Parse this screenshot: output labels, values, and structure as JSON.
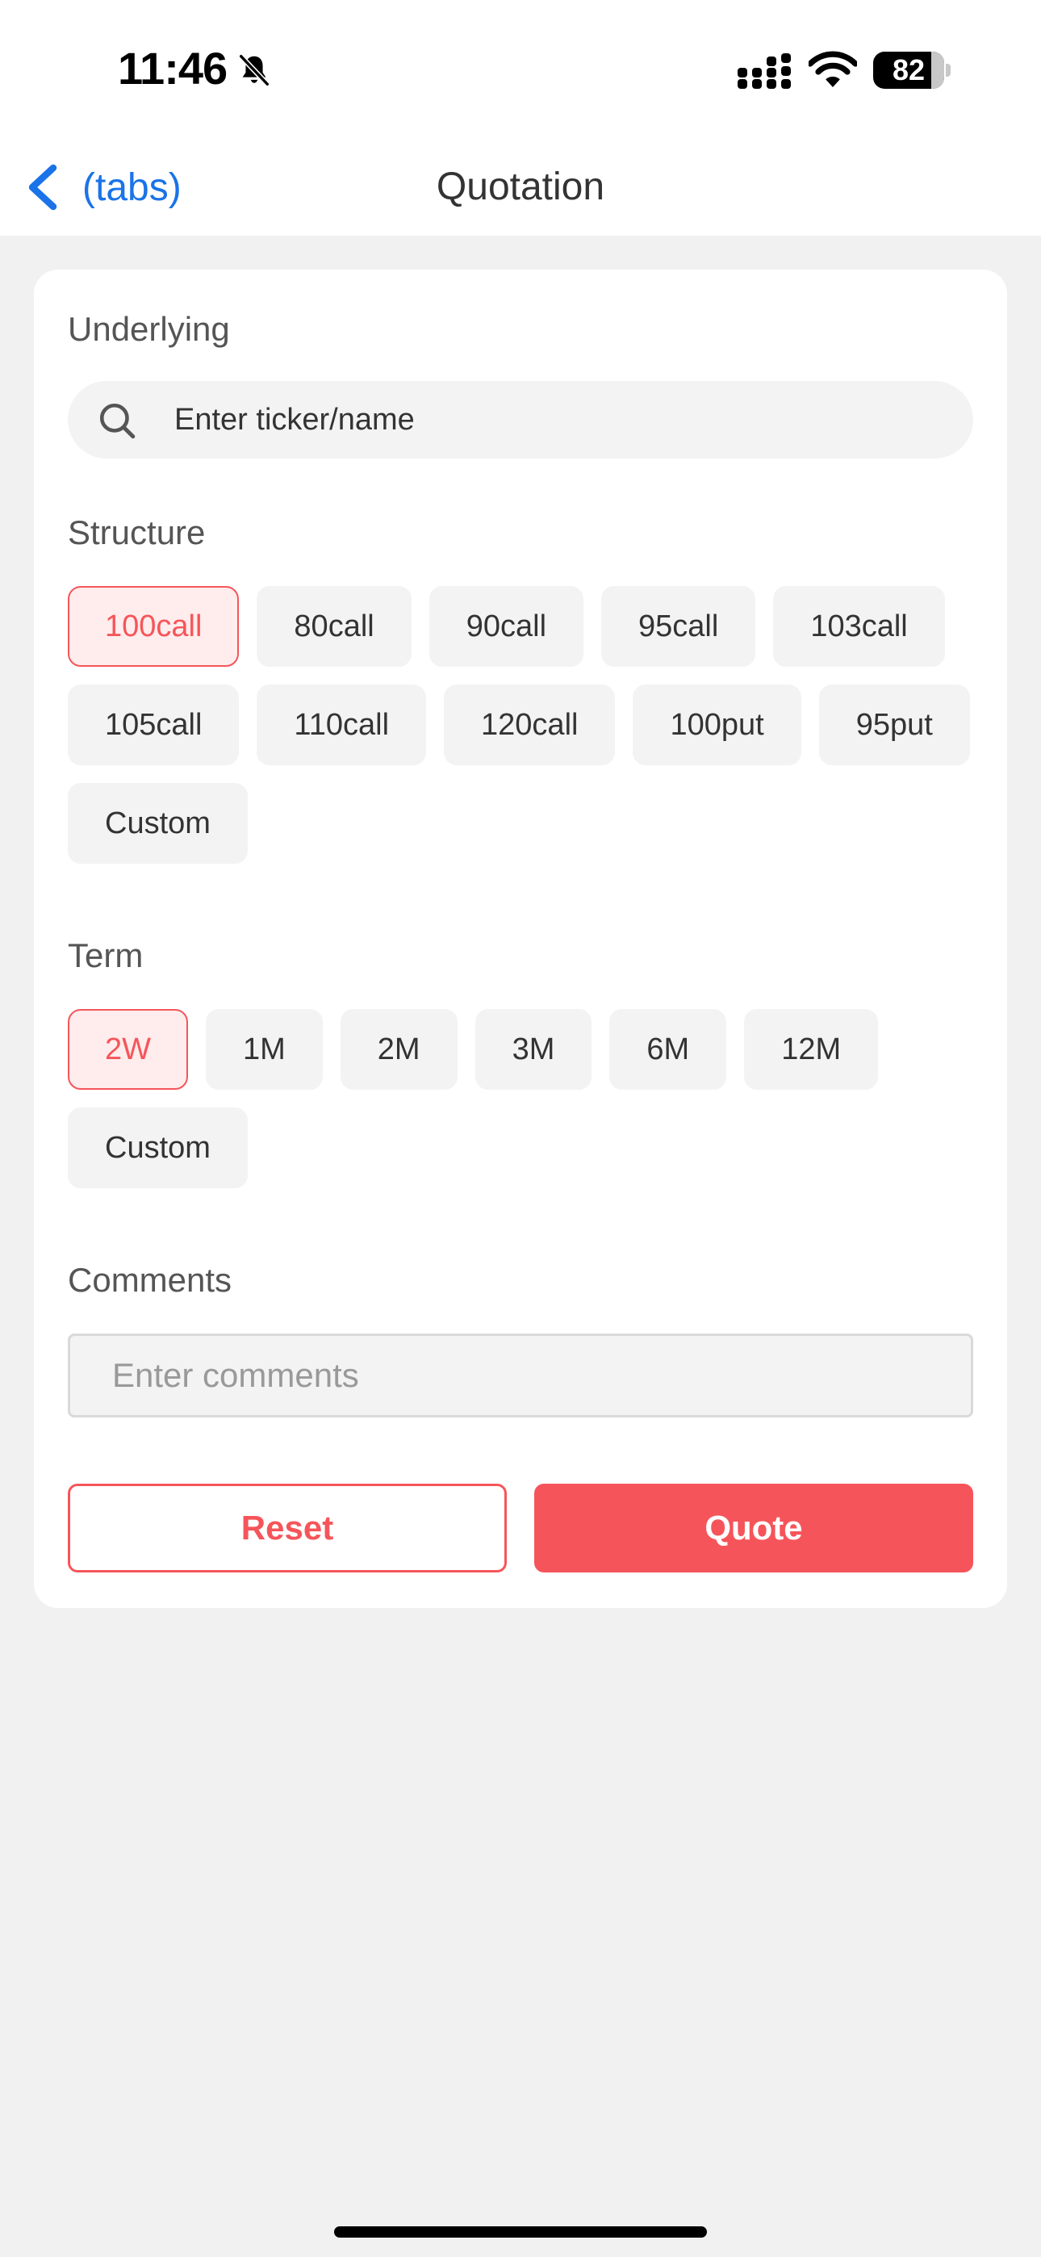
{
  "status_bar": {
    "time": "11:46",
    "battery_level": "82",
    "battery_fraction": 0.82,
    "icons": [
      "bell-slash-icon",
      "cellular-signal-icon",
      "wifi-icon",
      "battery-icon"
    ]
  },
  "nav": {
    "back_label": "(tabs)",
    "back_icon": "chevron-left-icon",
    "title": "Quotation"
  },
  "form": {
    "underlying": {
      "label": "Underlying",
      "placeholder": "Enter ticker/name",
      "icon": "search-icon"
    },
    "structure": {
      "label": "Structure",
      "options": [
        "100call",
        "80call",
        "90call",
        "95call",
        "103call",
        "105call",
        "110call",
        "120call",
        "100put",
        "95put",
        "Custom"
      ],
      "selected": "100call"
    },
    "term": {
      "label": "Term",
      "options": [
        "2W",
        "1M",
        "2M",
        "3M",
        "6M",
        "12M",
        "Custom"
      ],
      "selected": "2W"
    },
    "comments": {
      "label": "Comments",
      "placeholder": "Enter comments"
    },
    "reset_label": "Reset",
    "quote_label": "Quote"
  },
  "colors": {
    "accent": "#f5555a",
    "link": "#1a73e8",
    "background": "#f1f1f1"
  }
}
